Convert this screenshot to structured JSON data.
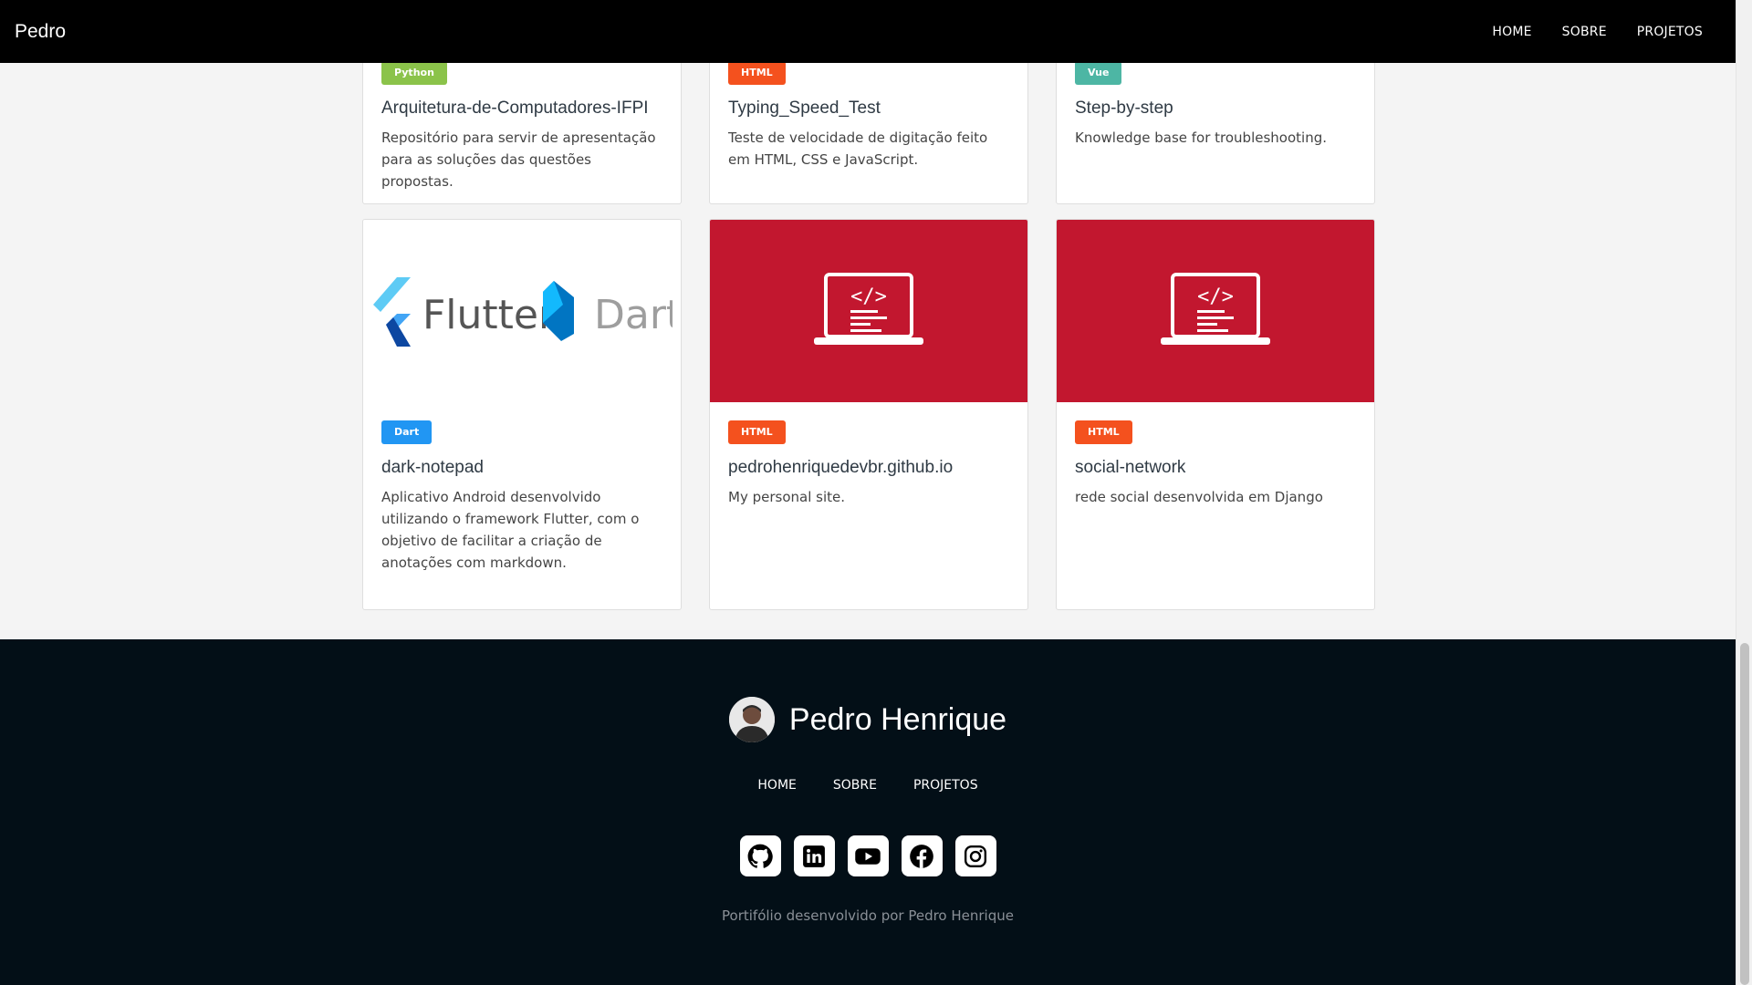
{
  "navbar": {
    "brand": "Pedro",
    "links": [
      "HOME",
      "SOBRE",
      "PROJETOS"
    ]
  },
  "projects": [
    {
      "badge": "Python",
      "badge_color": "#8bc34a",
      "title": "Arquitetura-de-Computadores-IFPI",
      "description": "Repositório para servir de apresentação para as soluções das questões propostas."
    },
    {
      "badge": "HTML",
      "badge_color": "#f4511e",
      "title": "Typing_Speed_Test",
      "description": "Teste de velocidade de digitação feito em HTML, CSS e JavaScript."
    },
    {
      "badge": "Vue",
      "badge_color": "#4db6a4",
      "title": "Step-by-step",
      "description": "Knowledge base for troubleshooting."
    },
    {
      "badge": "Dart",
      "badge_color": "#2196f3",
      "title": "dark-notepad",
      "description": "Aplicativo Android desenvolvido utilizando o framework Flutter, com o objetivo de facilitar a criação de anotações com markdown.",
      "thumb_logo": {
        "left": "Flutter",
        "right": "Dart"
      }
    },
    {
      "badge": "HTML",
      "badge_color": "#f4511e",
      "title": "pedrohenriquedevbr.github.io",
      "description": "My personal site.",
      "thumb_color": "#c2172f"
    },
    {
      "badge": "HTML",
      "badge_color": "#f4511e",
      "title": "social-network",
      "description": "rede social desenvolvida em Django",
      "thumb_color": "#c2172f"
    }
  ],
  "footer": {
    "name": "Pedro Henrique",
    "links": [
      "HOME",
      "SOBRE",
      "PROJETOS"
    ],
    "socials": [
      "github-icon",
      "linkedin-icon",
      "youtube-icon",
      "facebook-icon",
      "instagram-icon"
    ],
    "credit": "Portifólio desenvolvido por Pedro Henrique"
  }
}
